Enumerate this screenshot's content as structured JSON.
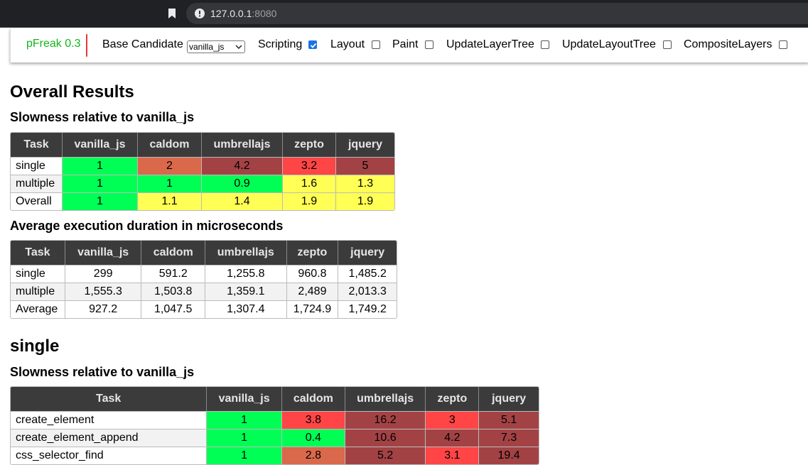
{
  "browser": {
    "url_host": "127.0.0.1",
    "url_port": ":8080"
  },
  "toolbar": {
    "brand": "pFreak 0.3",
    "base_candidate_label": "Base Candidate",
    "base_candidate_value": "vanilla_js",
    "options": [
      {
        "label": "Scripting",
        "checked": true
      },
      {
        "label": "Layout",
        "checked": false
      },
      {
        "label": "Paint",
        "checked": false
      },
      {
        "label": "UpdateLayerTree",
        "checked": false
      },
      {
        "label": "UpdateLayoutTree",
        "checked": false
      },
      {
        "label": "CompositeLayers",
        "checked": false
      }
    ]
  },
  "colors": {
    "green": "#00ff55",
    "yellow": "#ffff55",
    "orange": "#d9694a",
    "red": "#ff4545",
    "darkred": "#a34245"
  },
  "overall": {
    "title": "Overall Results",
    "slowness_title": "Slowness relative to vanilla_js",
    "headers": [
      "Task",
      "vanilla_js",
      "caldom",
      "umbrellajs",
      "zepto",
      "jquery"
    ],
    "slowness_rows": [
      {
        "task": "single",
        "cells": [
          {
            "v": "1",
            "c": "green"
          },
          {
            "v": "2",
            "c": "orange"
          },
          {
            "v": "4.2",
            "c": "darkred"
          },
          {
            "v": "3.2",
            "c": "red"
          },
          {
            "v": "5",
            "c": "darkred"
          }
        ]
      },
      {
        "task": "multiple",
        "cells": [
          {
            "v": "1",
            "c": "green"
          },
          {
            "v": "1",
            "c": "green"
          },
          {
            "v": "0.9",
            "c": "green"
          },
          {
            "v": "1.6",
            "c": "yellow"
          },
          {
            "v": "1.3",
            "c": "yellow"
          }
        ]
      },
      {
        "task": "Overall",
        "cells": [
          {
            "v": "1",
            "c": "green"
          },
          {
            "v": "1.1",
            "c": "yellow"
          },
          {
            "v": "1.4",
            "c": "yellow"
          },
          {
            "v": "1.9",
            "c": "yellow"
          },
          {
            "v": "1.9",
            "c": "yellow"
          }
        ]
      }
    ],
    "duration_title": "Average execution duration in microseconds",
    "duration_rows": [
      {
        "task": "single",
        "cells": [
          "299",
          "591.2",
          "1,255.8",
          "960.8",
          "1,485.2"
        ]
      },
      {
        "task": "multiple",
        "cells": [
          "1,555.3",
          "1,503.8",
          "1,359.1",
          "2,489",
          "2,013.3"
        ]
      },
      {
        "task": "Average",
        "cells": [
          "927.2",
          "1,047.5",
          "1,307.4",
          "1,724.9",
          "1,749.2"
        ]
      }
    ]
  },
  "single": {
    "title": "single",
    "slowness_title": "Slowness relative to vanilla_js",
    "headers": [
      "Task",
      "vanilla_js",
      "caldom",
      "umbrellajs",
      "zepto",
      "jquery"
    ],
    "rows": [
      {
        "task": "create_element",
        "cells": [
          {
            "v": "1",
            "c": "green"
          },
          {
            "v": "3.8",
            "c": "red"
          },
          {
            "v": "16.2",
            "c": "darkred"
          },
          {
            "v": "3",
            "c": "red"
          },
          {
            "v": "5.1",
            "c": "darkred"
          }
        ]
      },
      {
        "task": "create_element_append",
        "cells": [
          {
            "v": "1",
            "c": "green"
          },
          {
            "v": "0.4",
            "c": "green"
          },
          {
            "v": "10.6",
            "c": "darkred"
          },
          {
            "v": "4.2",
            "c": "darkred"
          },
          {
            "v": "7.3",
            "c": "darkred"
          }
        ]
      },
      {
        "task": "css_selector_find",
        "cells": [
          {
            "v": "1",
            "c": "green"
          },
          {
            "v": "2.8",
            "c": "orange"
          },
          {
            "v": "5.2",
            "c": "darkred"
          },
          {
            "v": "3.1",
            "c": "red"
          },
          {
            "v": "19.4",
            "c": "darkred"
          }
        ]
      }
    ]
  }
}
